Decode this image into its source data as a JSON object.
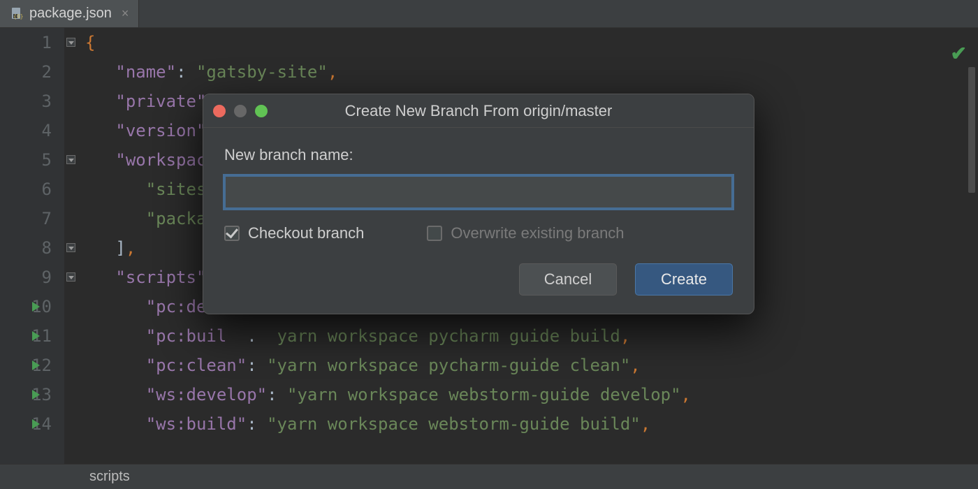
{
  "tab": {
    "filename": "package.json",
    "close_glyph": "×"
  },
  "editor": {
    "lines": [
      {
        "n": "1",
        "indent": 0,
        "tokens": [
          [
            "punc",
            "{"
          ]
        ]
      },
      {
        "n": "2",
        "indent": 1,
        "tokens": [
          [
            "key",
            "\""
          ],
          [
            "key",
            "name"
          ],
          [
            "key",
            "\""
          ],
          [
            "plain",
            ": "
          ],
          [
            "str",
            "\"gatsby-site\""
          ],
          [
            "punc",
            ","
          ]
        ]
      },
      {
        "n": "3",
        "indent": 1,
        "tokens": [
          [
            "key",
            "\""
          ],
          [
            "key",
            "private"
          ],
          [
            "key",
            "\""
          ]
        ]
      },
      {
        "n": "4",
        "indent": 1,
        "tokens": [
          [
            "key",
            "\""
          ],
          [
            "key",
            "version"
          ],
          [
            "key",
            "\""
          ]
        ]
      },
      {
        "n": "5",
        "indent": 1,
        "tokens": [
          [
            "key",
            "\""
          ],
          [
            "key",
            "workspac"
          ]
        ],
        "fold": true
      },
      {
        "n": "6",
        "indent": 2,
        "tokens": [
          [
            "str",
            "\"sites/"
          ]
        ]
      },
      {
        "n": "7",
        "indent": 2,
        "tokens": [
          [
            "str",
            "\"packag"
          ]
        ]
      },
      {
        "n": "8",
        "indent": 1,
        "tokens": [
          [
            "plain",
            "]"
          ],
          [
            "punc",
            ","
          ]
        ],
        "fold": true
      },
      {
        "n": "9",
        "indent": 1,
        "tokens": [
          [
            "key",
            "\""
          ],
          [
            "key",
            "scripts"
          ],
          [
            "key",
            "\""
          ]
        ],
        "fold": true
      },
      {
        "n": "10",
        "indent": 2,
        "tokens": [
          [
            "key",
            "\""
          ],
          [
            "key",
            "pc:de"
          ]
        ],
        "run": true
      },
      {
        "n": "11",
        "indent": 2,
        "tokens": [
          [
            "key",
            "\""
          ],
          [
            "key",
            "pc:buil"
          ],
          [
            "plain",
            "  .  "
          ],
          [
            "str",
            "yarn workspace pycharm guide build"
          ],
          [
            "punc",
            ","
          ]
        ],
        "run": true
      },
      {
        "n": "12",
        "indent": 2,
        "tokens": [
          [
            "key",
            "\""
          ],
          [
            "key",
            "pc:clean"
          ],
          [
            "key",
            "\""
          ],
          [
            "plain",
            ": "
          ],
          [
            "str",
            "\"yarn workspace pycharm-guide clean\""
          ],
          [
            "punc",
            ","
          ]
        ],
        "run": true
      },
      {
        "n": "13",
        "indent": 2,
        "tokens": [
          [
            "key",
            "\""
          ],
          [
            "key",
            "ws:develop"
          ],
          [
            "key",
            "\""
          ],
          [
            "plain",
            ": "
          ],
          [
            "str",
            "\"yarn workspace webstorm-guide develop\""
          ],
          [
            "punc",
            ","
          ]
        ],
        "run": true
      },
      {
        "n": "14",
        "indent": 2,
        "tokens": [
          [
            "key",
            "\""
          ],
          [
            "key",
            "ws:build"
          ],
          [
            "key",
            "\""
          ],
          [
            "plain",
            ": "
          ],
          [
            "str",
            "\"yarn workspace webstorm-guide build\""
          ],
          [
            "punc",
            ","
          ]
        ],
        "run": true
      }
    ]
  },
  "breadcrumb": {
    "path": "scripts"
  },
  "dialog": {
    "title": "Create New Branch From origin/master",
    "label": "New branch name:",
    "input_value": "",
    "checkbox_checkout": "Checkout branch",
    "checkbox_overwrite": "Overwrite existing branch",
    "cancel": "Cancel",
    "create": "Create"
  },
  "folds": [
    {
      "line": 1
    },
    {
      "line": 5
    },
    {
      "line": 8
    },
    {
      "line": 9
    }
  ]
}
